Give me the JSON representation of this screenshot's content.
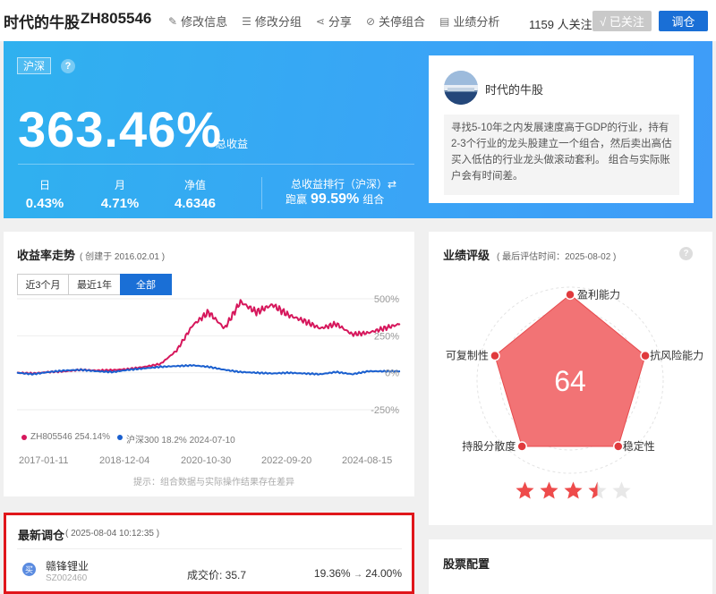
{
  "header": {
    "portfolio_name": "时代的牛股",
    "portfolio_code": "ZH805546",
    "actions": [
      {
        "icon": "pencil-icon",
        "glyph": "✎",
        "label": "修改信息"
      },
      {
        "icon": "list-icon",
        "glyph": "☰",
        "label": "修改分组"
      },
      {
        "icon": "share-icon",
        "glyph": "⋖",
        "label": "分享"
      },
      {
        "icon": "stop-icon",
        "glyph": "⊘",
        "label": "关停组合"
      },
      {
        "icon": "chart-doc-icon",
        "glyph": "▤",
        "label": "业绩分析"
      }
    ],
    "follow_count": "1159 人关注",
    "followed_label": "√ 已关注",
    "rebalance_label": "调仓"
  },
  "hero": {
    "market": "沪深",
    "help": "?",
    "total_return": "363.46%",
    "total_return_label": "总收益",
    "metrics": [
      {
        "label": "日",
        "value": "0.43%"
      },
      {
        "label": "月",
        "value": "4.71%"
      },
      {
        "label": "净值",
        "value": "4.6346"
      }
    ],
    "rank_label": "总收益排行（沪深）⇄",
    "rank_prefix": "跑赢",
    "rank_value": "99.59%",
    "rank_suffix": "组合",
    "description": {
      "name": "时代的牛股",
      "text": "寻找5-10年之内发展速度高于GDP的行业，持有2-3个行业的龙头股建立一个组合，然后卖出高估买入低估的行业龙头做滚动套利。 组合与实际账户会有时间差。"
    }
  },
  "returns_panel": {
    "title": "收益率走势",
    "created": "( 创建于 2016.02.01 )",
    "tabs": [
      "近3个月",
      "最近1年",
      "全部"
    ],
    "active_tab": 2,
    "y_ticks": [
      "500%",
      "250%",
      "0%",
      "-250%"
    ],
    "legend": [
      {
        "text": "ZH805546 254.14%",
        "color": "#d6175c"
      },
      {
        "text": "沪深300 18.2% 2024-07-10",
        "color": "#1a5fcf"
      }
    ],
    "x_ticks": [
      "2017-01-11",
      "2018-12-04",
      "2020-10-30",
      "2022-09-20",
      "2024-08-15"
    ],
    "hint": "提示：组合数据与实际操作结果存在差异"
  },
  "chart_data": {
    "type": "line",
    "x": [
      "2016-02",
      "2016-08",
      "2017-01",
      "2017-07",
      "2018-01",
      "2018-07",
      "2018-12",
      "2019-06",
      "2019-12",
      "2020-06",
      "2020-10",
      "2021-02",
      "2021-06",
      "2021-10",
      "2022-02",
      "2022-06",
      "2022-09",
      "2023-01",
      "2023-05",
      "2023-09",
      "2024-01",
      "2024-05",
      "2024-08",
      "2025-01",
      "2025-08"
    ],
    "series": [
      {
        "name": "ZH805546",
        "color": "#d6175c",
        "values": [
          0,
          -5,
          5,
          10,
          20,
          15,
          18,
          25,
          40,
          60,
          150,
          320,
          410,
          300,
          480,
          410,
          460,
          390,
          350,
          300,
          330,
          260,
          270,
          300,
          330
        ]
      },
      {
        "name": "沪深300",
        "color": "#1a5fcf",
        "values": [
          0,
          -10,
          5,
          15,
          20,
          10,
          5,
          20,
          30,
          40,
          45,
          50,
          40,
          20,
          5,
          0,
          -5,
          0,
          -5,
          -10,
          5,
          -10,
          10,
          10,
          10
        ]
      }
    ],
    "ylim": [
      -250,
      500
    ],
    "yticks": [
      "500%",
      "250%",
      "0%",
      "-250%"
    ],
    "xticks": [
      "2017-01-11",
      "2018-12-04",
      "2020-10-30",
      "2022-09-20",
      "2024-08-15"
    ]
  },
  "rating_panel": {
    "title": "业绩评级",
    "subtitle": "( 最后评估时间：2025-08-02 )",
    "help": "?",
    "score": "64",
    "axes": [
      {
        "label": "盈利能力",
        "value": 0.92
      },
      {
        "label": "抗风险能力",
        "value": 0.85
      },
      {
        "label": "稳定性",
        "value": 0.88
      },
      {
        "label": "持股分散度",
        "value": 0.88
      },
      {
        "label": "可复制性",
        "value": 0.85
      }
    ],
    "stars": 3.5,
    "star_color": "#ee4b4b"
  },
  "latest_trade": {
    "title": "最新调仓",
    "time": "( 2025-08-04 10:12:35 )",
    "badge": "买",
    "stock_name": "赣锋锂业",
    "stock_code": "SZ002460",
    "price_label": "成交价: 35.7",
    "weight_from": "19.36%",
    "arrow": "→",
    "weight_to": "24.00%"
  },
  "holdings_panel": {
    "title": "股票配置"
  }
}
